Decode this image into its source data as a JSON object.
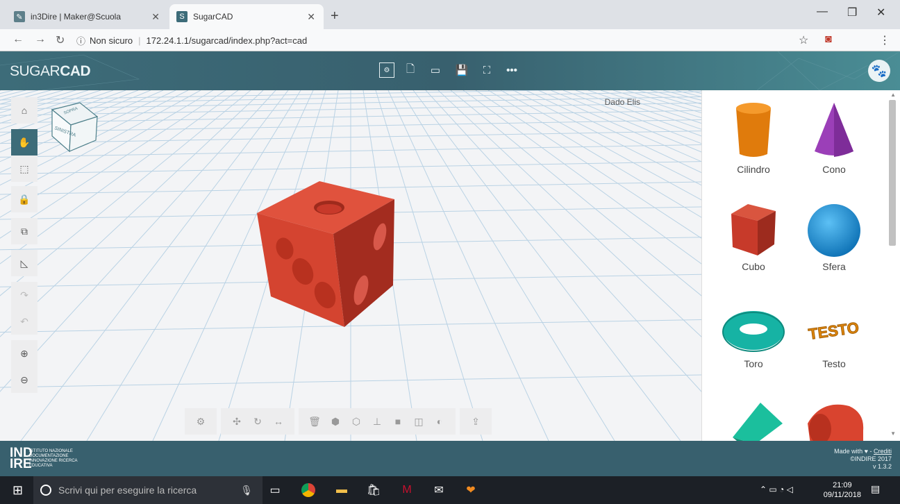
{
  "browser": {
    "tabs": [
      {
        "title": "in3Dire | Maker@Scuola",
        "active": false
      },
      {
        "title": "SugarCAD",
        "active": true
      }
    ],
    "favicon_s": "S",
    "address": {
      "security": "Non sicuro",
      "url": "172.24.1.1/sugarcad/index.php?act=cad"
    }
  },
  "app": {
    "logo_light": "SUGAR",
    "logo_bold": "CAD",
    "object_name": "Dado Elis",
    "view_cube_label": "SINISTRA",
    "view_cube_top": "SOPRA"
  },
  "shapes": [
    {
      "label": "Cilindro",
      "color": "#e07b0c"
    },
    {
      "label": "Cono",
      "color": "#9b3fb8"
    },
    {
      "label": "Cubo",
      "color": "#c73a2a"
    },
    {
      "label": "Sfera",
      "color": "#1d8fd8"
    },
    {
      "label": "Toro",
      "color": "#16b3a4"
    },
    {
      "label": "Testo",
      "color": "#e0870c",
      "text": "TESTO"
    }
  ],
  "footer": {
    "org": "IND\nIRE",
    "org_sub": "ISTITUTO NAZIONALE DOCUMENTAZIONE INNOVAZIONE RICERCA EDUCATIVA",
    "made_with": "Made with ",
    "credits": "Crediti",
    "copyright": "©INDIRE 2017",
    "version": "v 1.3.2"
  },
  "taskbar": {
    "search_placeholder": "Scrivi qui per eseguire la ricerca",
    "time": "21:09",
    "date": "09/11/2018"
  },
  "colors": {
    "header": "#3d6c79",
    "dice": "#d9442f",
    "grid": "#b9d2e4"
  }
}
